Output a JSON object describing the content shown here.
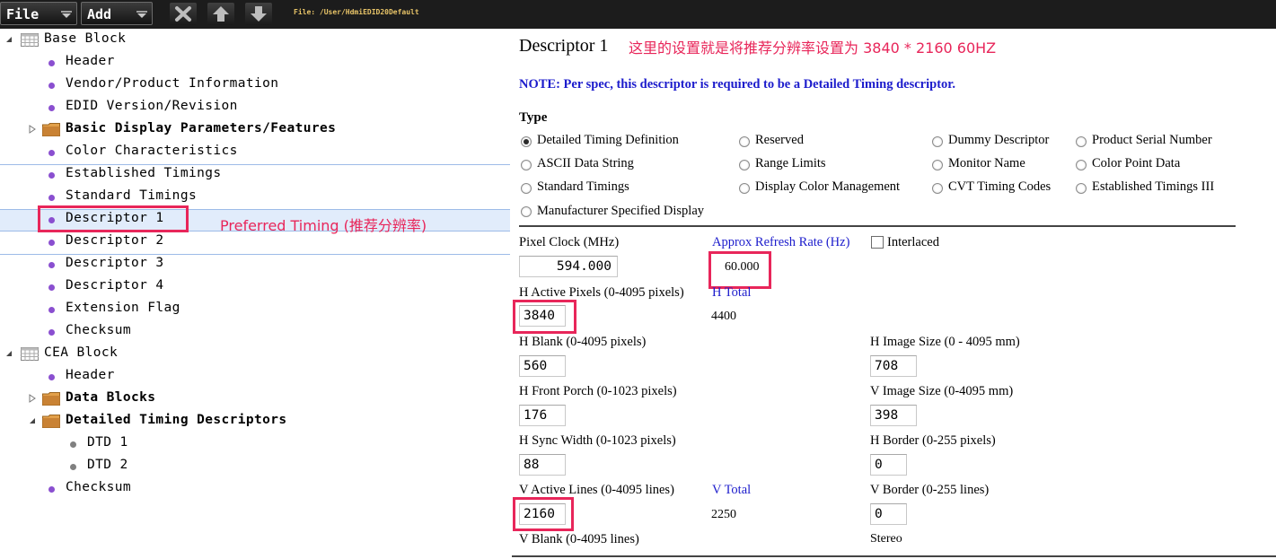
{
  "toolbar": {
    "file_label": "File",
    "add_label": "Add",
    "file_path": "File: /User/HdmiEDID20Default"
  },
  "tree": {
    "base_block": "Base Block",
    "base_items": [
      "Header",
      "Vendor/Product Information",
      "EDID Version/Revision",
      "Basic Display Parameters/Features",
      "Color Characteristics",
      "Established Timings",
      "Standard Timings",
      "Descriptor 1",
      "Descriptor 2",
      "Descriptor 3",
      "Descriptor 4",
      "Extension Flag",
      "Checksum"
    ],
    "cea_block": "CEA Block",
    "cea_items": [
      "Header",
      "Data Blocks",
      "Detailed Timing Descriptors"
    ],
    "dtd_items": [
      "DTD 1",
      "DTD 2"
    ],
    "cea_checksum": "Checksum",
    "annotation": "Preferred Timing (推荐分辨率)"
  },
  "panel": {
    "title": "Descriptor 1",
    "title_annotation": "这里的设置就是将推荐分辨率设置为 3840 * 2160 60HZ",
    "note": "NOTE: Per spec, this descriptor is required to be a Detailed Timing descriptor.",
    "type_label": "Type",
    "types": [
      "Detailed Timing Definition",
      "Reserved",
      "Dummy Descriptor",
      "Product Serial Number",
      "ASCII Data String",
      "Range Limits",
      "Monitor Name",
      "Color Point Data",
      "Standard Timings",
      "Display Color Management",
      "CVT Timing Codes",
      "Established Timings III",
      "Manufacturer Specified Display"
    ],
    "selected_type": "Detailed Timing Definition",
    "pixel_clock_label": "Pixel Clock (MHz)",
    "pixel_clock": "594.000",
    "refresh_label": "Approx Refresh Rate (Hz)",
    "refresh": "60.000",
    "interlaced_label": "Interlaced",
    "h_active_label": "H Active Pixels (0-4095 pixels)",
    "h_active": "3840",
    "h_total_label": "H Total",
    "h_total": "4400",
    "h_blank_label": "H Blank (0-4095 pixels)",
    "h_blank": "560",
    "h_image_label": "H Image Size (0 - 4095 mm)",
    "h_image": "708",
    "h_front_label": "H Front Porch (0-1023 pixels)",
    "h_front": "176",
    "v_image_label": "V Image Size (0-4095 mm)",
    "v_image": "398",
    "h_sync_label": "H Sync Width (0-1023 pixels)",
    "h_sync": "88",
    "h_border_label": "H Border (0-255 pixels)",
    "h_border": "0",
    "v_active_label": "V Active Lines (0-4095 lines)",
    "v_active": "2160",
    "v_total_label": "V Total",
    "v_total": "2250",
    "v_border_label": "V Border (0-255 lines)",
    "v_border": "0",
    "v_blank_label": "V Blank (0-4095 lines)",
    "stereo_label": "Stereo"
  },
  "colors": {
    "highlight": "#e8265a",
    "link_blue": "#1c1ccc",
    "node_bullet": "#8a4fd0"
  }
}
